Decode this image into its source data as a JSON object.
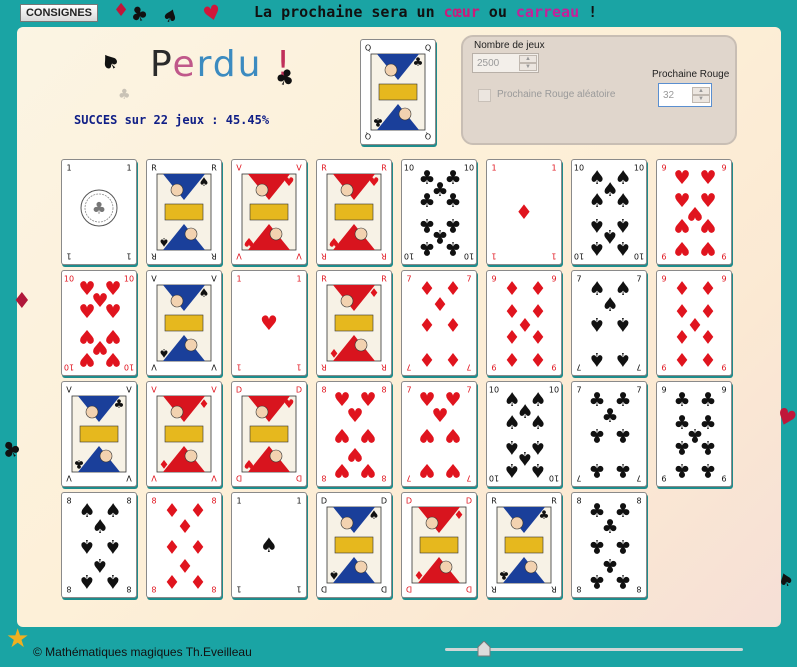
{
  "toolbar": {
    "consignes_label": "CONSIGNES"
  },
  "headline": {
    "before": "La prochaine sera un ",
    "coeur": "cœur",
    "middle": " ou ",
    "carreau": "carreau",
    "after": " !"
  },
  "result": {
    "letters": [
      "P",
      "e",
      "r",
      "d",
      "u",
      " ",
      "!"
    ],
    "letter_colors": [
      "#2a2a2a",
      "#c0588a",
      "#3c8bc0",
      "#3c8bc0",
      "#3c8bc0",
      "#2a2a2a",
      "#c0305a"
    ]
  },
  "score": {
    "text": "SUCCES sur 22 jeux : 45.45%"
  },
  "settings": {
    "games_label": "Nombre de jeux",
    "games_value": "2500",
    "random_label": "Prochaine  Rouge aléatoire",
    "next_red_label": "Prochaine Rouge",
    "next_red_value": "32"
  },
  "target_card": {
    "rank": "Q",
    "suit": "club"
  },
  "cards": [
    {
      "rank": "1",
      "suit": "club",
      "face": "ace"
    },
    {
      "rank": "R",
      "suit": "spade",
      "face": "court"
    },
    {
      "rank": "V",
      "suit": "heart",
      "face": "court"
    },
    {
      "rank": "R",
      "suit": "heart",
      "face": "court"
    },
    {
      "rank": "10",
      "suit": "club",
      "face": "pips"
    },
    {
      "rank": "1",
      "suit": "diamond",
      "face": "ace"
    },
    {
      "rank": "10",
      "suit": "spade",
      "face": "pips"
    },
    {
      "rank": "9",
      "suit": "heart",
      "face": "pips"
    },
    {
      "rank": "10",
      "suit": "heart",
      "face": "pips"
    },
    {
      "rank": "V",
      "suit": "spade",
      "face": "court"
    },
    {
      "rank": "1",
      "suit": "heart",
      "face": "ace"
    },
    {
      "rank": "R",
      "suit": "diamond",
      "face": "court"
    },
    {
      "rank": "7",
      "suit": "diamond",
      "face": "pips"
    },
    {
      "rank": "9",
      "suit": "diamond",
      "face": "pips"
    },
    {
      "rank": "7",
      "suit": "spade",
      "face": "pips"
    },
    {
      "rank": "9",
      "suit": "diamond",
      "face": "pips"
    },
    {
      "rank": "V",
      "suit": "club",
      "face": "court"
    },
    {
      "rank": "V",
      "suit": "diamond",
      "face": "court"
    },
    {
      "rank": "D",
      "suit": "heart",
      "face": "court"
    },
    {
      "rank": "8",
      "suit": "heart",
      "face": "pips"
    },
    {
      "rank": "7",
      "suit": "heart",
      "face": "pips"
    },
    {
      "rank": "10",
      "suit": "spade",
      "face": "pips"
    },
    {
      "rank": "7",
      "suit": "club",
      "face": "pips"
    },
    {
      "rank": "9",
      "suit": "club",
      "face": "pips"
    },
    {
      "rank": "8",
      "suit": "spade",
      "face": "pips"
    },
    {
      "rank": "8",
      "suit": "diamond",
      "face": "pips"
    },
    {
      "rank": "1",
      "suit": "spade",
      "face": "ace"
    },
    {
      "rank": "D",
      "suit": "spade",
      "face": "court"
    },
    {
      "rank": "D",
      "suit": "diamond",
      "face": "court"
    },
    {
      "rank": "R",
      "suit": "club",
      "face": "court"
    },
    {
      "rank": "8",
      "suit": "club",
      "face": "pips"
    }
  ],
  "footer": {
    "text": "© Mathématiques magiques Th.Eveilleau"
  },
  "slider": {
    "value_fraction": 0.13
  },
  "colors": {
    "teal": "#1aa4a4",
    "red": "#e0141e",
    "black": "#111111"
  }
}
